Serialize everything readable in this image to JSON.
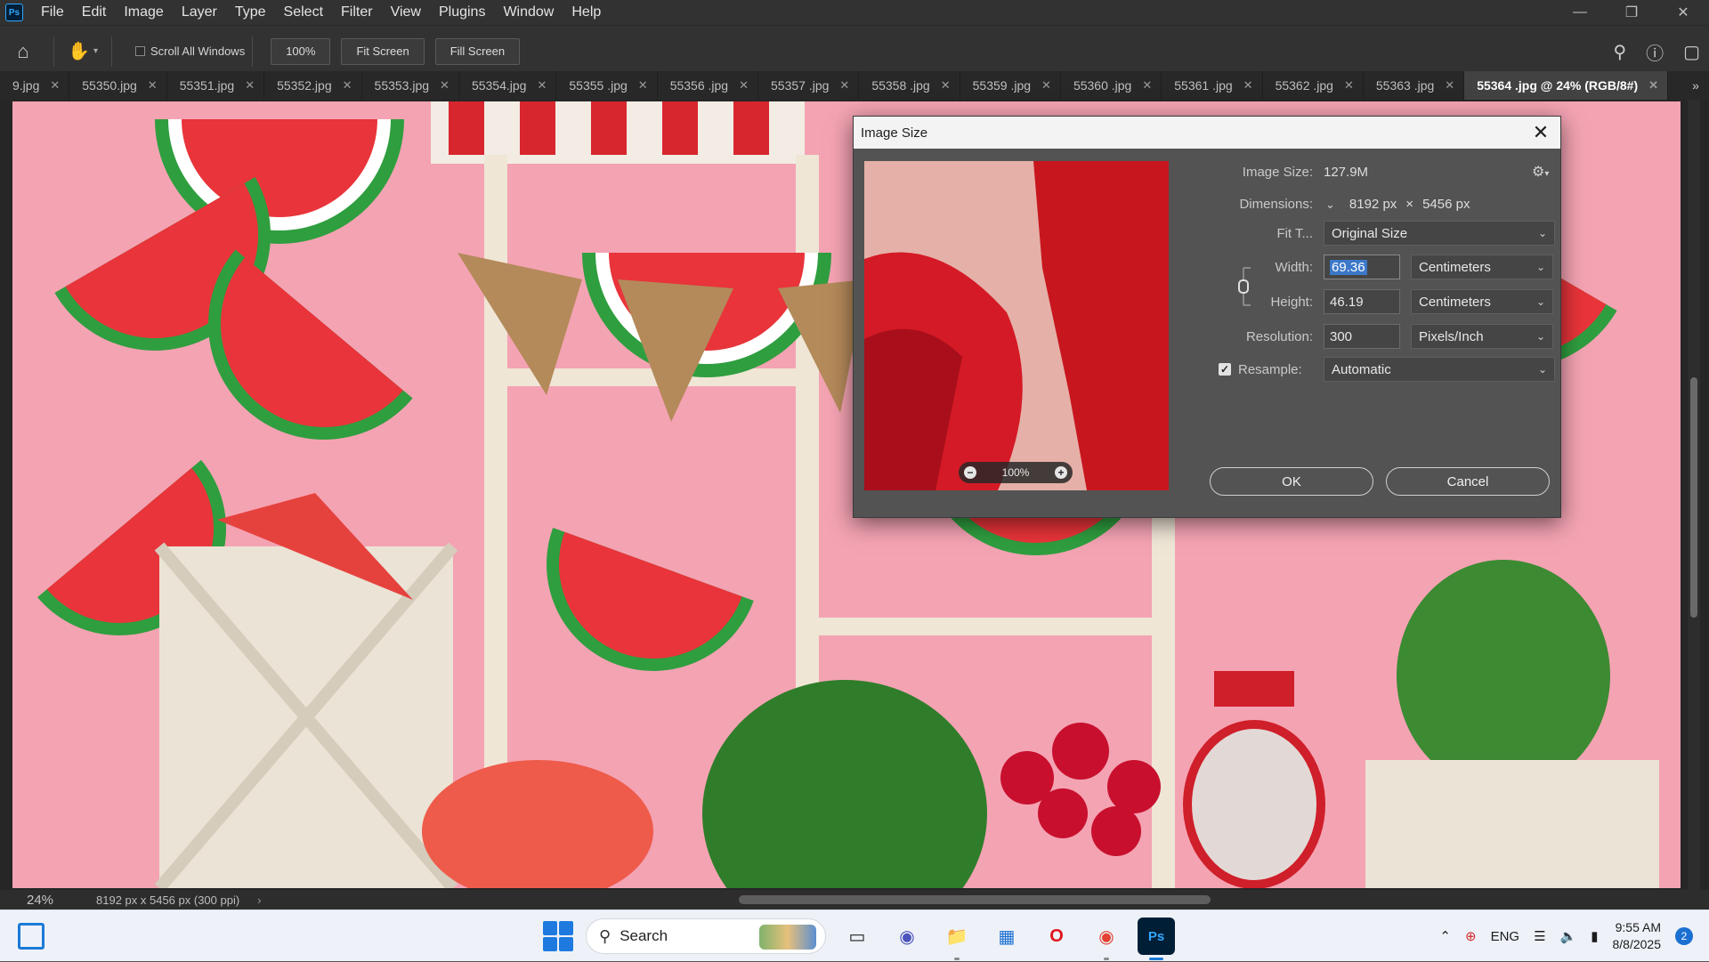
{
  "app": {
    "logo": "Ps"
  },
  "menu": [
    "File",
    "Edit",
    "Image",
    "Layer",
    "Type",
    "Select",
    "Filter",
    "View",
    "Plugins",
    "Window",
    "Help"
  ],
  "options": {
    "scroll_all_label": "Scroll All Windows",
    "zoom_btn": "100%",
    "fit_screen": "Fit Screen",
    "fill_screen": "Fill Screen"
  },
  "tabs": [
    {
      "label": "9.jpg"
    },
    {
      "label": "55350.jpg"
    },
    {
      "label": "55351.jpg"
    },
    {
      "label": "55352.jpg"
    },
    {
      "label": "55353.jpg"
    },
    {
      "label": "55354.jpg"
    },
    {
      "label": "55355 .jpg"
    },
    {
      "label": "55356 .jpg"
    },
    {
      "label": "55357 .jpg"
    },
    {
      "label": "55358 .jpg"
    },
    {
      "label": "55359 .jpg"
    },
    {
      "label": "55360 .jpg"
    },
    {
      "label": "55361 .jpg"
    },
    {
      "label": "55362 .jpg"
    },
    {
      "label": "55363 .jpg"
    },
    {
      "label": "55364 .jpg @ 24% (RGB/8#)",
      "active": true
    }
  ],
  "status": {
    "zoom": "24%",
    "info": "8192 px x 5456 px (300 ppi)"
  },
  "dialog": {
    "title": "Image Size",
    "image_size_label": "Image Size:",
    "image_size_value": "127.9M",
    "dimensions_label": "Dimensions:",
    "dim_w": "8192 px",
    "dim_x": "×",
    "dim_h": "5456 px",
    "fit_label": "Fit T...",
    "fit_value": "Original Size",
    "width_label": "Width:",
    "width_value": "69.36",
    "width_unit": "Centimeters",
    "height_label": "Height:",
    "height_value": "46.19",
    "height_unit": "Centimeters",
    "resolution_label": "Resolution:",
    "resolution_value": "300",
    "resolution_unit": "Pixels/Inch",
    "resample_label": "Resample:",
    "resample_value": "Automatic",
    "preview_zoom": "100%",
    "ok": "OK",
    "cancel": "Cancel"
  },
  "taskbar": {
    "search_label": "Search",
    "lang": "ENG",
    "time": "9:55 AM",
    "date": "8/8/2025",
    "notifications": "2"
  }
}
